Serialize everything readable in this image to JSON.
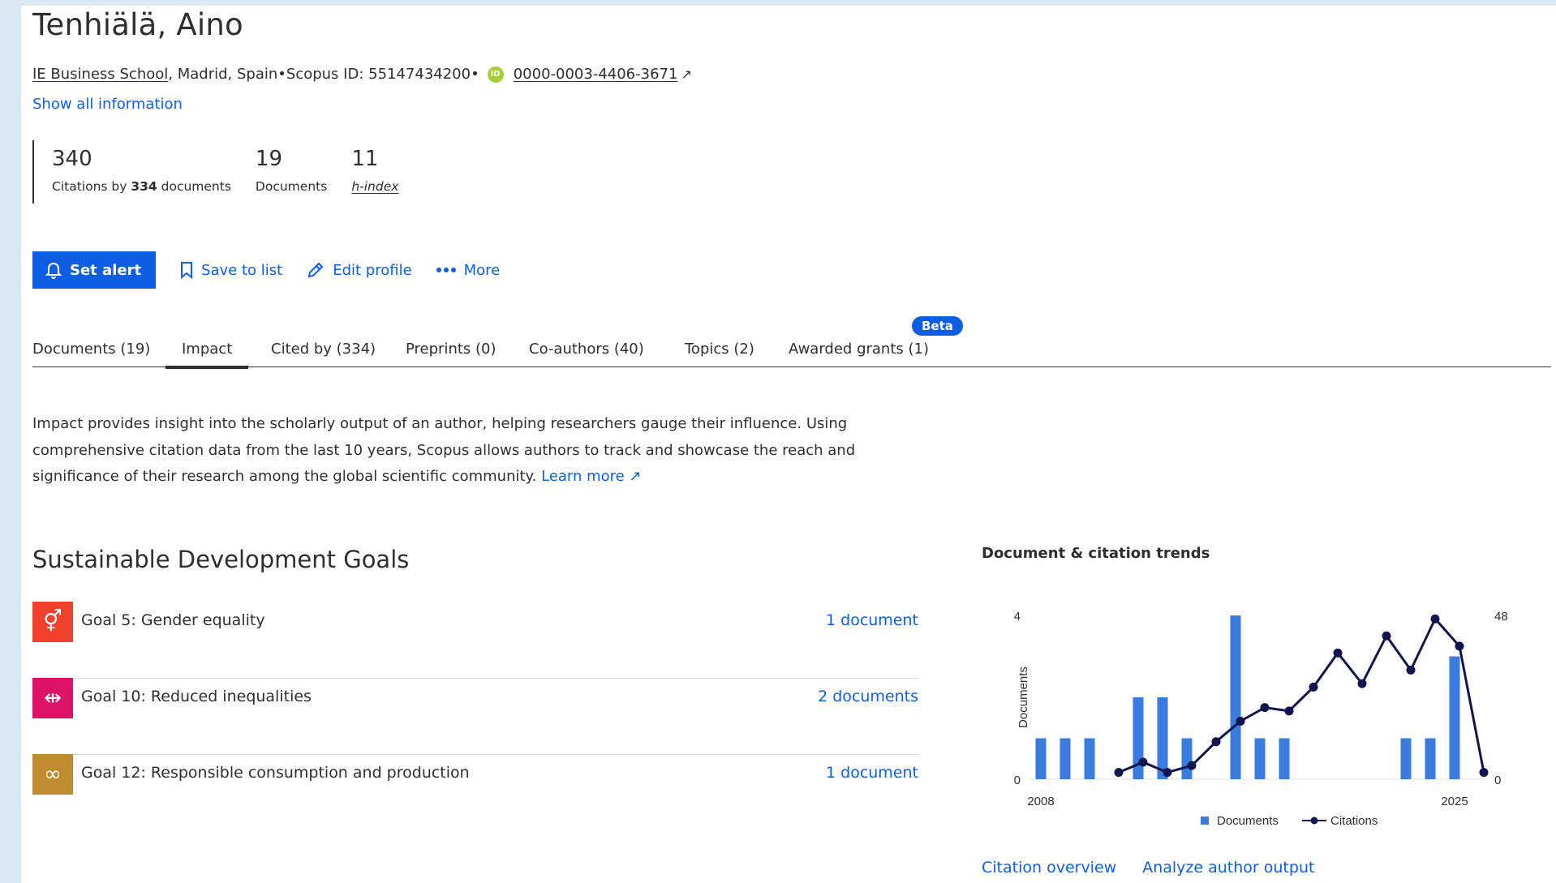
{
  "author": {
    "name": "Tenhiälä, Aino",
    "affiliation": "IE Business School",
    "location": ", Madrid, Spain",
    "separator": " • ",
    "scopus_id": "Scopus ID: 55147434200",
    "orcid_icon": "iD",
    "orcid": "0000-0003-4406-3671",
    "show_all": "Show all information"
  },
  "metrics": [
    {
      "value": "340",
      "label_pre": "Citations by ",
      "label_bold": "334",
      "label_post": " documents"
    },
    {
      "value": "19",
      "label": "Documents"
    },
    {
      "value": "11",
      "label": "h-index"
    }
  ],
  "actions": {
    "set_alert": "Set alert",
    "save_to_list": "Save to list",
    "edit_profile": "Edit profile",
    "more": "More"
  },
  "tabs": [
    {
      "label": "Documents (19)"
    },
    {
      "label": "Impact"
    },
    {
      "label": "Cited by (334)"
    },
    {
      "label": "Preprints (0)"
    },
    {
      "label": "Co-authors (40)"
    },
    {
      "label": "Topics (2)"
    },
    {
      "label": "Awarded grants (1)"
    }
  ],
  "beta": "Beta",
  "impact": {
    "description": "Impact provides insight into the scholarly output of an author, helping researchers gauge their influence. Using comprehensive citation data from the last 10 years, Scopus allows authors to track and showcase the reach and significance of their research among the global scientific community.",
    "learn_more": "Learn more"
  },
  "sdg": {
    "title": "Sustainable Development Goals",
    "goals": [
      {
        "name": "Goal 5: Gender equality",
        "count": "1 document",
        "color": "#ef402b",
        "icon": "⚥"
      },
      {
        "name": "Goal 10: Reduced inequalities",
        "count": "2 documents",
        "color": "#dd1367",
        "icon": "⇹"
      },
      {
        "name": "Goal 12: Responsible consumption and production",
        "count": "1 document",
        "color": "#bf8b2e",
        "icon": "∞"
      }
    ]
  },
  "chart_data": {
    "type": "bar",
    "title": "Document & citation trends",
    "x": [
      2008,
      2009,
      2010,
      2011,
      2012,
      2013,
      2014,
      2015,
      2016,
      2017,
      2018,
      2019,
      2020,
      2021,
      2022,
      2023,
      2024,
      2025
    ],
    "x_tick_labels": [
      "2008",
      "2025"
    ],
    "series": [
      {
        "name": "Documents",
        "kind": "bar",
        "axis": "left",
        "color": "#3a7be0",
        "values": [
          1,
          1,
          1,
          0,
          2,
          2,
          1,
          0,
          4,
          1,
          1,
          0,
          0,
          0,
          0,
          1,
          1,
          3
        ]
      },
      {
        "name": "Citations",
        "kind": "line",
        "axis": "right",
        "color": "#11154d",
        "points": [
          [
            2011.2,
            2
          ],
          [
            2012.2,
            5
          ],
          [
            2013.2,
            2
          ],
          [
            2014.2,
            4
          ],
          [
            2015.2,
            11
          ],
          [
            2016.2,
            17
          ],
          [
            2017.2,
            21
          ],
          [
            2018.2,
            20
          ],
          [
            2019.2,
            27
          ],
          [
            2020.2,
            37
          ],
          [
            2021.2,
            28
          ],
          [
            2022.2,
            42
          ],
          [
            2023.2,
            32
          ],
          [
            2024.2,
            47
          ],
          [
            2025.2,
            39
          ],
          [
            2026.2,
            2
          ]
        ]
      }
    ],
    "ylabel": "Documents",
    "y2label": "Citations",
    "ylim": [
      0,
      4
    ],
    "y2lim": [
      0,
      48
    ],
    "y_tick_labels": [
      "0",
      "4"
    ],
    "y2_tick_labels": [
      "0",
      "48"
    ],
    "legend": "bottom",
    "grid": false
  },
  "chart_links": {
    "citation_overview": "Citation overview",
    "analyze": "Analyze author output"
  }
}
